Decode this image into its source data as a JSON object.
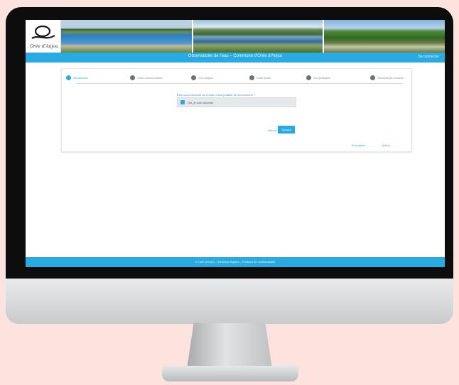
{
  "app": {
    "logo_text": "Orée d'Anjou"
  },
  "navbar": {
    "title": "Observatoire de l'eau – Commune d'Orée d'Anjou",
    "right_link": "Se connecter"
  },
  "steps": [
    {
      "label": "Introduction",
      "active": true
    },
    {
      "label": "Votre consommation",
      "active": false
    },
    {
      "label": "Vos usages",
      "active": false
    },
    {
      "label": "Votre jardin",
      "active": false
    },
    {
      "label": "Vos pratiques",
      "active": false
    },
    {
      "label": "Résultats et conseils",
      "active": false
    }
  ],
  "form": {
    "question": "Êtes-vous raccordé au réseau d'eau potable de la commune ?",
    "answer": "Oui, je suis raccordé",
    "prev_label": "Retour",
    "next_label": "Suivant"
  },
  "links": {
    "link1": "Enregistrer",
    "link2": "Quitter"
  },
  "footer": {
    "text": "© Orée d'Anjou – Mentions légales – Politique de confidentialité"
  },
  "colors": {
    "accent": "#29abe2",
    "page_background": "#fde3de",
    "bezel": "#0d0d0d"
  }
}
